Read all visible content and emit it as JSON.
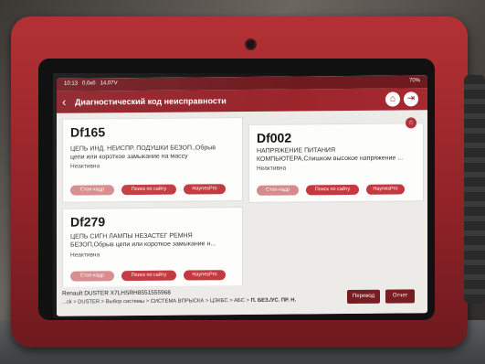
{
  "status": {
    "time": "10:13",
    "net": "0,0кб",
    "voltage": "14,07V",
    "battery": "70%"
  },
  "appbar": {
    "title": "Диагностический код неисправности"
  },
  "dtcs": [
    {
      "code": "Df165",
      "line1": "ЦЕПЬ ИНД. НЕИСПР. ПОДУШКИ БЕЗОП.,Обрыв",
      "line2": "цепи или короткое замыкание на массу",
      "state": "Неактивна"
    },
    {
      "code": "Df002",
      "line1": "НАПРЯЖЕНИЕ ПИТАНИЯ",
      "line2": "КОМПЬЮТЕРА,Слишком высокое напряжение ...",
      "state": "Неактивна"
    },
    {
      "code": "Df279",
      "line1": "ЦЕПЬ СИГН ЛАМПЫ НЕЗАСТЕГ РЕМНЯ",
      "line2": "БЕЗОП,Обрыв цепи или короткое замыкание н...",
      "state": "Неактивна"
    }
  ],
  "buttons": {
    "freeze": "Стоп-кадр",
    "search": "Поиск по сайту",
    "haynes": "HaynesPro"
  },
  "footer": {
    "vin": "Renault  DUSTER  X7LHSRH8551555968",
    "path": "...ck > DUSTER > Выбор системы > СИСТЕМА ВПРЫСКА > ЦЭКБС > АБС > ",
    "path_bold": "П. БЕЗ./УС. ПР. Н.",
    "translate": "Перевод",
    "report": "Отчет"
  }
}
